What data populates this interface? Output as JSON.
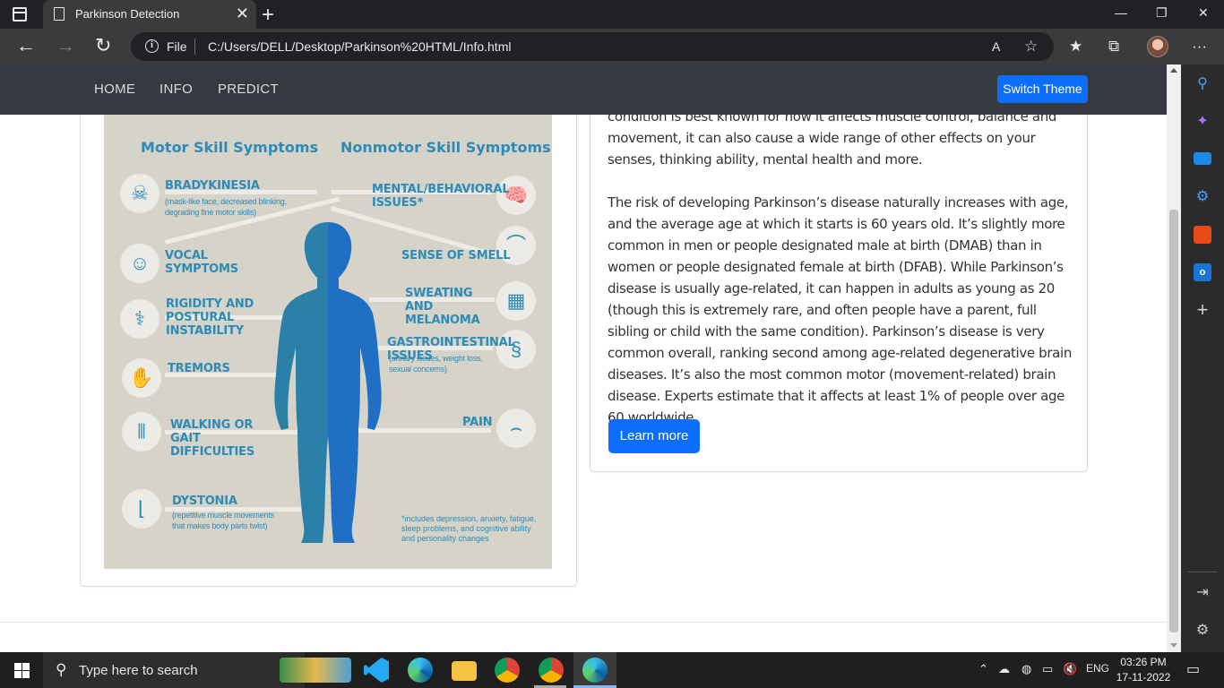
{
  "browser": {
    "tab_title": "Parkinson Detection",
    "tab_close": "✕",
    "new_tab": "+",
    "address_scheme": "File",
    "address_url": "C:/Users/DELL/Desktop/Parkinson%20HTML/Info.html",
    "window_controls": {
      "minimize": "—",
      "restore": "❐",
      "close": "✕"
    },
    "nav": {
      "back": "←",
      "forward": "→",
      "reload": "↻"
    },
    "toolbar": {
      "read_aloud": "A",
      "add_favorite": "☆",
      "favorites": "★",
      "collections": "⧉",
      "more": "···"
    }
  },
  "site": {
    "nav_links": [
      "HOME",
      "INFO",
      "PREDICT"
    ],
    "switch_theme": "Switch Theme",
    "learn_more": "Learn more",
    "paragraph_top_partial": "condition is best known for how it affects muscle control, balance and movement, it can also cause a wide range of other effects on your senses, thinking ability, mental health and more.",
    "paragraph_main": "The risk of developing Parkinson’s disease naturally increases with age, and the average age at which it starts is 60 years old. It’s slightly more common in men or people designated male at birth (DMAB) than in women or people designated female at birth (DFAB). While Parkinson’s disease is usually age-related, it can happen in adults as young as 20 (though this is extremely rare, and often people have a parent, full sibling or child with the same condition). Parkinson’s disease is very common overall, ranking second among age-related degenerative brain diseases. It’s also the most common motor (movement-related) brain disease. Experts estimate that it affects at least 1% of people over age 60 worldwide."
  },
  "infographic": {
    "heading_motor": "Motor Skill Symptoms",
    "heading_nonmotor": "Nonmotor Skill Symptoms",
    "motor": [
      {
        "label": "BRADYKINESIA",
        "sub": "(mask-like face, decreased blinking, degrading fine motor skills)",
        "icon": "skull-icon"
      },
      {
        "label": "VOCAL SYMPTOMS",
        "sub": "",
        "icon": "head-profile-icon"
      },
      {
        "label": "RIGIDITY AND POSTURAL INSTABILITY",
        "sub": "",
        "icon": "spine-icon"
      },
      {
        "label": "TREMORS",
        "sub": "",
        "icon": "hand-icon"
      },
      {
        "label": "WALKING OR GAIT DIFFICULTIES",
        "sub": "",
        "icon": "legs-icon"
      },
      {
        "label": "DYSTONIA",
        "sub": "(repetitive muscle movements that makes body parts twist)",
        "icon": "foot-icon"
      }
    ],
    "nonmotor": [
      {
        "label": "MENTAL/BEHAVIORAL ISSUES*",
        "sub": "",
        "icon": "brain-icon"
      },
      {
        "label": "SENSE OF SMELL",
        "sub": "",
        "icon": "nose-icon"
      },
      {
        "label": "SWEATING AND MELANOMA",
        "sub": "",
        "icon": "skin-icon"
      },
      {
        "label": "GASTROINTESTINAL ISSUES",
        "sub": "(urinary issues, weight loss, sexual concerns)",
        "icon": "intestine-icon"
      },
      {
        "label": "PAIN",
        "sub": "",
        "icon": "knee-icon"
      }
    ],
    "footnote": "*includes depression, anxiety, fatigue, sleep problems, and cognitive ability and personality changes"
  },
  "taskbar": {
    "search_placeholder": "Type here to search",
    "language": "ENG",
    "time": "03:26 PM",
    "date": "17-11-2022"
  },
  "colors": {
    "navbar": "#343a40",
    "primary_button": "#0d6efd",
    "infographic_bg": "#d6d3c9",
    "infographic_text": "#2d8bb8"
  }
}
